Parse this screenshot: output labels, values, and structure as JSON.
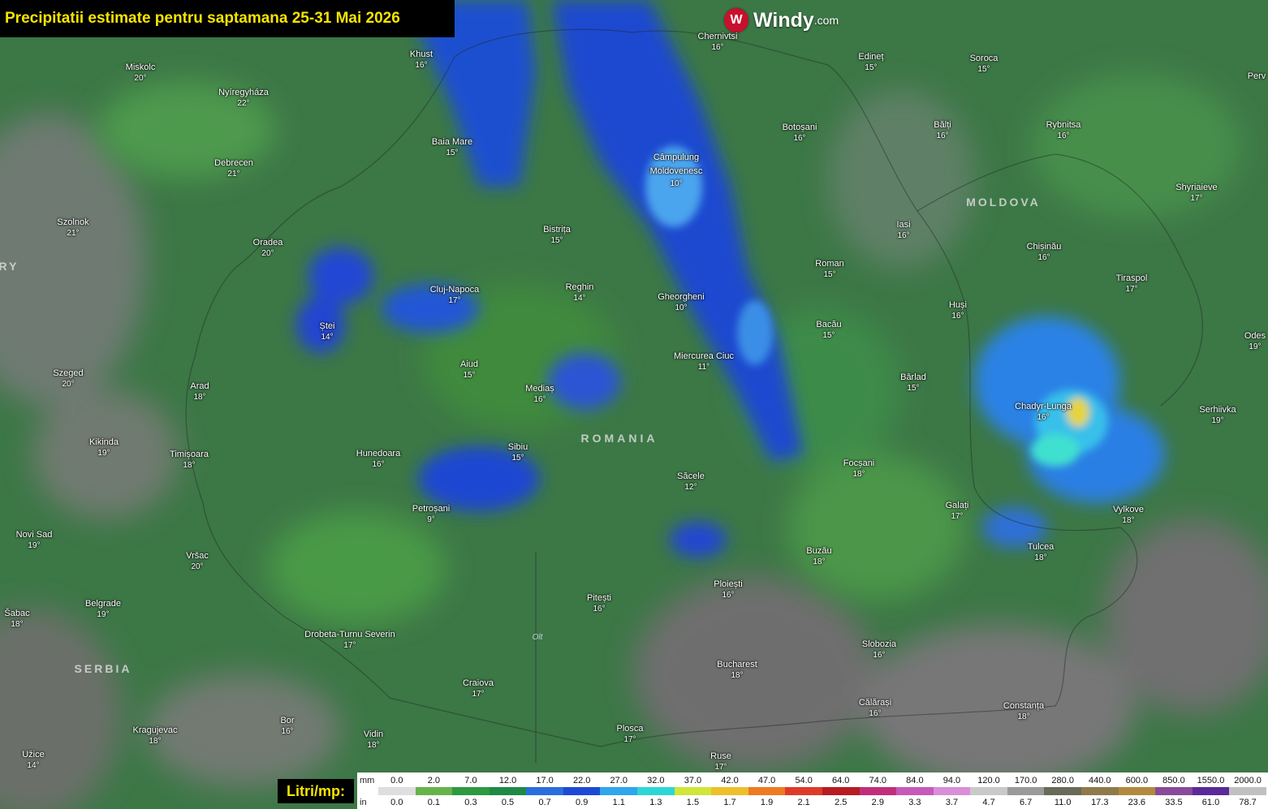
{
  "title": "Precipitatii estimate pentru saptamana 25-31 Mai 2026",
  "logo": {
    "brand": "Windy",
    "domain": ".com",
    "icon": "windy-logo-icon"
  },
  "legend": {
    "label": "Litri/mp:",
    "unit_mm": "mm",
    "unit_in": "in",
    "mm_values": [
      "0.0",
      "2.0",
      "7.0",
      "12.0",
      "17.0",
      "22.0",
      "27.0",
      "32.0",
      "37.0",
      "42.0",
      "47.0",
      "54.0",
      "64.0",
      "74.0",
      "84.0",
      "94.0",
      "120.0",
      "170.0",
      "280.0",
      "440.0",
      "600.0",
      "850.0",
      "1550.0",
      "2000.0"
    ],
    "in_values": [
      "0.0",
      "0.1",
      "0.3",
      "0.5",
      "0.7",
      "0.9",
      "1.1",
      "1.3",
      "1.5",
      "1.7",
      "1.9",
      "2.1",
      "2.5",
      "2.9",
      "3.3",
      "3.7",
      "4.7",
      "6.7",
      "11.0",
      "17.3",
      "23.6",
      "33.5",
      "61.0",
      "78.7"
    ],
    "colors": [
      "#dedede",
      "#67b34a",
      "#2e9940",
      "#1e8a46",
      "#2a6edc",
      "#1d49d6",
      "#2fa7ea",
      "#2dd6d6",
      "#cfe63a",
      "#eebf2c",
      "#ee7a22",
      "#de3a2a",
      "#b61c20",
      "#c12f7a",
      "#c65ab8",
      "#d98ed8",
      "#c9c9c9",
      "#9a9a9a",
      "#6a6a5a",
      "#8f7a4a",
      "#b28a3f",
      "#8a4a9a",
      "#5a2a9a",
      "#c0c0c0"
    ]
  },
  "countries": [
    {
      "name": "ROMANIA"
    },
    {
      "name": "MOLDOVA"
    },
    {
      "name": "SERBIA"
    },
    {
      "name": "RY"
    }
  ],
  "river": "Olt",
  "cities": [
    {
      "name": "Chernivtsi",
      "temp": "16°"
    },
    {
      "name": "Khust",
      "temp": "16°"
    },
    {
      "name": "Edineț",
      "temp": "15°"
    },
    {
      "name": "Soroca",
      "temp": "15°"
    },
    {
      "name": "Miskolc",
      "temp": "20°"
    },
    {
      "name": "Nyíregyháza",
      "temp": "22°"
    },
    {
      "name": "Baia Mare",
      "temp": "15°"
    },
    {
      "name": "Botoșani",
      "temp": "16°"
    },
    {
      "name": "Bălți",
      "temp": "16°"
    },
    {
      "name": "Rybnitsa",
      "temp": "16°"
    },
    {
      "name": "Debrecen",
      "temp": "21°"
    },
    {
      "name": "Câmpulung Moldovenesc",
      "temp": "10°"
    },
    {
      "name": "Shyriaieve",
      "temp": "17°"
    },
    {
      "name": "Szolnok",
      "temp": "21°"
    },
    {
      "name": "Bistrița",
      "temp": "15°"
    },
    {
      "name": "Iasi",
      "temp": "16°"
    },
    {
      "name": "Chișinău",
      "temp": "16°"
    },
    {
      "name": "Oradea",
      "temp": "20°"
    },
    {
      "name": "Roman",
      "temp": "15°"
    },
    {
      "name": "Tiraspol",
      "temp": "17°"
    },
    {
      "name": "Cluj-Napoca",
      "temp": "17°"
    },
    {
      "name": "Reghin",
      "temp": "14°"
    },
    {
      "name": "Gheorgheni",
      "temp": "10°"
    },
    {
      "name": "Huși",
      "temp": "16°"
    },
    {
      "name": "Ștei",
      "temp": "14°"
    },
    {
      "name": "Bacău",
      "temp": "15°"
    },
    {
      "name": "Odes",
      "temp": "19°"
    },
    {
      "name": "Miercurea Ciuc",
      "temp": "11°"
    },
    {
      "name": "Aiud",
      "temp": "15°"
    },
    {
      "name": "Szeged",
      "temp": "20°"
    },
    {
      "name": "Bârlad",
      "temp": "15°"
    },
    {
      "name": "Arad",
      "temp": "18°"
    },
    {
      "name": "Mediaș",
      "temp": "16°"
    },
    {
      "name": "Chadyr-Lunga",
      "temp": "16°"
    },
    {
      "name": "Serhiivka",
      "temp": "19°"
    },
    {
      "name": "Kikinda",
      "temp": "19°"
    },
    {
      "name": "Sibiu",
      "temp": "15°"
    },
    {
      "name": "Timișoara",
      "temp": "18°"
    },
    {
      "name": "Hunedoara",
      "temp": "16°"
    },
    {
      "name": "Focșani",
      "temp": "18°"
    },
    {
      "name": "Săcele",
      "temp": "12°"
    },
    {
      "name": "Galați",
      "temp": "17°"
    },
    {
      "name": "Vylkove",
      "temp": "18°"
    },
    {
      "name": "Petroșani",
      "temp": "9°"
    },
    {
      "name": "Novi Sad",
      "temp": "19°"
    },
    {
      "name": "Tulcea",
      "temp": "18°"
    },
    {
      "name": "Buzău",
      "temp": "18°"
    },
    {
      "name": "Vršac",
      "temp": "20°"
    },
    {
      "name": "Ploiești",
      "temp": "16°"
    },
    {
      "name": "Pitești",
      "temp": "16°"
    },
    {
      "name": "Belgrade",
      "temp": "19°"
    },
    {
      "name": "Šabac",
      "temp": "18°"
    },
    {
      "name": "Drobeta-Turnu Severin",
      "temp": "17°"
    },
    {
      "name": "Slobozia",
      "temp": "16°"
    },
    {
      "name": "Bucharest",
      "temp": "18°"
    },
    {
      "name": "Craiova",
      "temp": "17°"
    },
    {
      "name": "Călărași",
      "temp": "16°"
    },
    {
      "name": "Constanța",
      "temp": "18°"
    },
    {
      "name": "Bor",
      "temp": "16°"
    },
    {
      "name": "Kragujevac",
      "temp": "18°"
    },
    {
      "name": "Plosca",
      "temp": "17°"
    },
    {
      "name": "Vidin",
      "temp": "18°"
    },
    {
      "name": "Užice",
      "temp": "14°"
    },
    {
      "name": "Ruse",
      "temp": "17°"
    },
    {
      "name": "Perv",
      "temp": ""
    }
  ]
}
